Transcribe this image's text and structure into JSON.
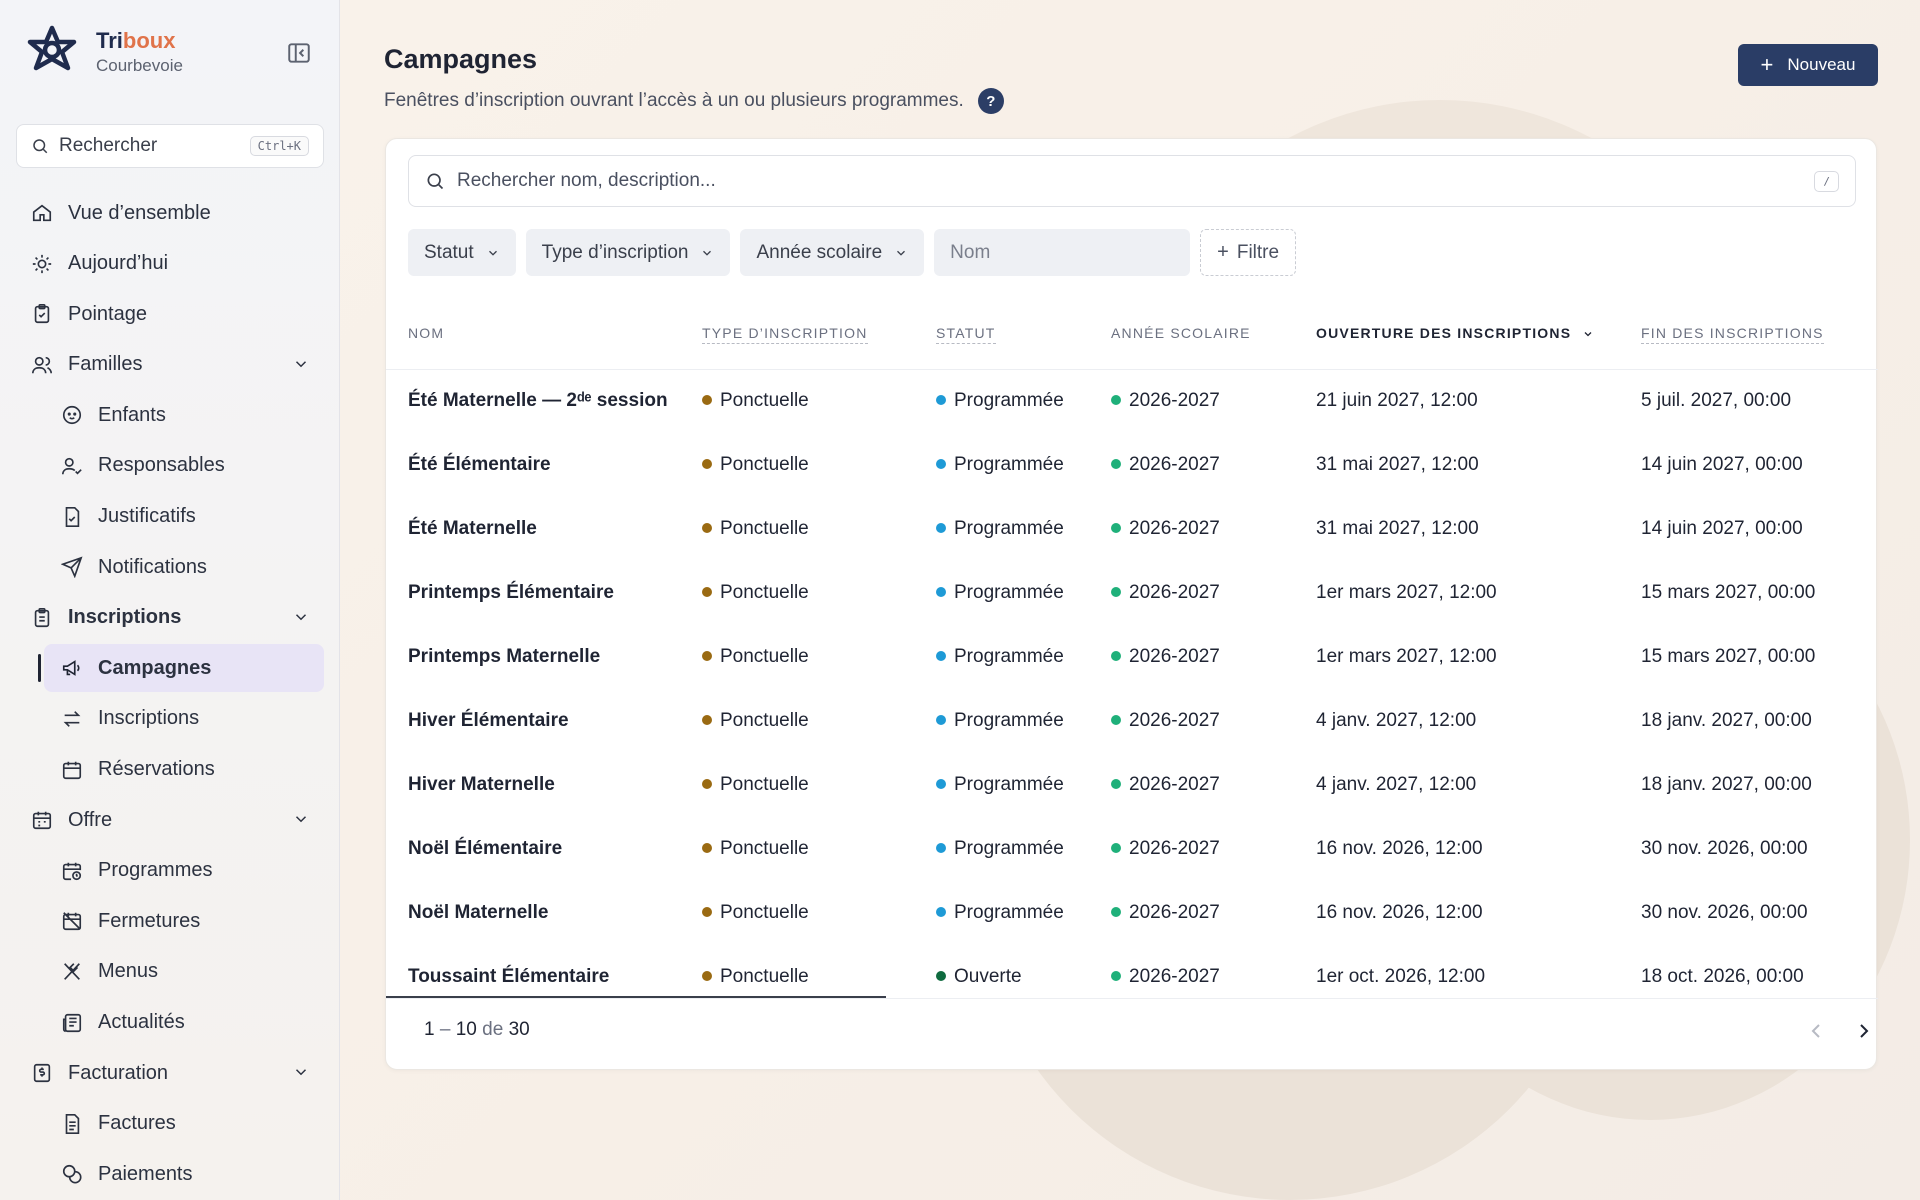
{
  "brand": {
    "name_part1": "Tri",
    "name_part2": "boux",
    "city": "Courbevoie"
  },
  "sidebar": {
    "search_label": "Rechercher",
    "search_shortcut": "Ctrl+K",
    "items": [
      {
        "label": "Vue d’ensemble",
        "icon": "home-icon"
      },
      {
        "label": "Aujourd’hui",
        "icon": "sun-icon"
      },
      {
        "label": "Pointage",
        "icon": "clipboard-check-icon"
      },
      {
        "label": "Familles",
        "icon": "users-icon"
      },
      {
        "label": "Enfants",
        "icon": "baby-icon"
      },
      {
        "label": "Responsables",
        "icon": "user-check-icon"
      },
      {
        "label": "Justificatifs",
        "icon": "file-check-icon"
      },
      {
        "label": "Notifications",
        "icon": "send-icon"
      },
      {
        "label": "Inscriptions",
        "icon": "clipboard-list-icon"
      },
      {
        "label": "Campagnes",
        "icon": "megaphone-icon"
      },
      {
        "label": "Inscriptions",
        "icon": "arrows-exchange-icon"
      },
      {
        "label": "Réservations",
        "icon": "calendar-icon"
      },
      {
        "label": "Offre",
        "icon": "calendar-grid-icon"
      },
      {
        "label": "Programmes",
        "icon": "calendar-clock-icon"
      },
      {
        "label": "Fermetures",
        "icon": "calendar-off-icon"
      },
      {
        "label": "Menus",
        "icon": "utensils-icon"
      },
      {
        "label": "Actualités",
        "icon": "newspaper-icon"
      },
      {
        "label": "Facturation",
        "icon": "receipt-icon"
      },
      {
        "label": "Factures",
        "icon": "file-text-icon"
      },
      {
        "label": "Paiements",
        "icon": "coins-icon"
      }
    ]
  },
  "header": {
    "title": "Campagnes",
    "subtitle": "Fenêtres d’inscription ouvrant l’accès à un ou plusieurs programmes.",
    "help": "?",
    "new_button": "Nouveau"
  },
  "search": {
    "placeholder": "Rechercher nom, description...",
    "shortcut": "/"
  },
  "filters": {
    "statut": "Statut",
    "type": "Type d’inscription",
    "annee": "Année scolaire",
    "nom": "Nom",
    "add": "Filtre"
  },
  "table": {
    "columns": [
      "NOM",
      "TYPE D’INSCRIPTION",
      "STATUT",
      "ANNÉE SCOLAIRE",
      "OUVERTURE DES INSCRIPTIONS",
      "FIN DES INSCRIPTIONS"
    ],
    "rows": [
      [
        "Été Maternelle — 2ᵈᵉ session",
        "Ponctuelle",
        "Programmée",
        "2026-2027",
        "21 juin 2027, 12:00",
        "5 juil. 2027, 00:00"
      ],
      [
        "Été Élémentaire",
        "Ponctuelle",
        "Programmée",
        "2026-2027",
        "31 mai 2027, 12:00",
        "14 juin 2027, 00:00"
      ],
      [
        "Été Maternelle",
        "Ponctuelle",
        "Programmée",
        "2026-2027",
        "31 mai 2027, 12:00",
        "14 juin 2027, 00:00"
      ],
      [
        "Printemps Élémentaire",
        "Ponctuelle",
        "Programmée",
        "2026-2027",
        "1er mars 2027, 12:00",
        "15 mars 2027, 00:00"
      ],
      [
        "Printemps Maternelle",
        "Ponctuelle",
        "Programmée",
        "2026-2027",
        "1er mars 2027, 12:00",
        "15 mars 2027, 00:00"
      ],
      [
        "Hiver Élémentaire",
        "Ponctuelle",
        "Programmée",
        "2026-2027",
        "4 janv. 2027, 12:00",
        "18 janv. 2027, 00:00"
      ],
      [
        "Hiver Maternelle",
        "Ponctuelle",
        "Programmée",
        "2026-2027",
        "4 janv. 2027, 12:00",
        "18 janv. 2027, 00:00"
      ],
      [
        "Noël Élémentaire",
        "Ponctuelle",
        "Programmée",
        "2026-2027",
        "16 nov. 2026, 12:00",
        "30 nov. 2026, 00:00"
      ],
      [
        "Noël Maternelle",
        "Ponctuelle",
        "Programmée",
        "2026-2027",
        "16 nov. 2026, 12:00",
        "30 nov. 2026, 00:00"
      ],
      [
        "Toussaint Élémentaire",
        "Ponctuelle",
        "Ouverte",
        "2026-2027",
        "1er oct. 2026, 12:00",
        "18 oct. 2026, 00:00"
      ]
    ]
  },
  "pagination": {
    "start": "1",
    "sep": "–",
    "end": "10",
    "of": "de",
    "total": "30"
  },
  "colors": {
    "type_dot": "#9a6a12",
    "programmee_dot": "#1e9ad6",
    "ouverte_dot": "#0f6b3f",
    "annee_dot": "#1fb07a",
    "primary": "#2a3d66",
    "brand_accent": "#e0734a"
  }
}
